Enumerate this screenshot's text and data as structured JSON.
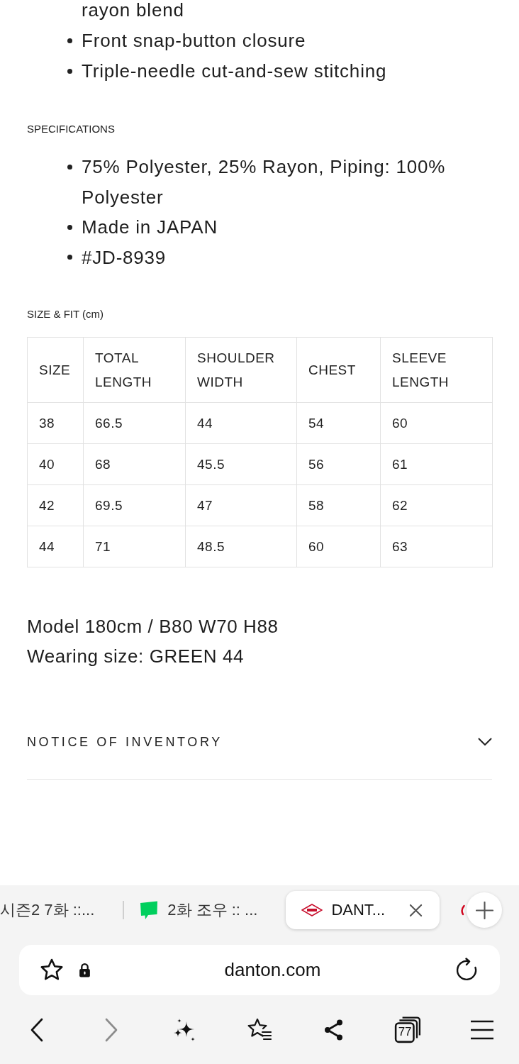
{
  "product_features": [
    {
      "kind": "continuation",
      "text": "rayon blend"
    },
    {
      "kind": "bullet",
      "text": "Front snap-button closure"
    },
    {
      "kind": "bullet",
      "text": "Triple-needle cut-and-sew stitching"
    }
  ],
  "specifications": {
    "heading": "SPECIFICATIONS",
    "items": [
      "75% Polyester, 25% Rayon, Piping: 100% Polyester",
      "Made in JAPAN",
      "#JD-8939"
    ]
  },
  "size_fit": {
    "heading": "SIZE & FIT (cm)",
    "table": {
      "columns": [
        "SIZE",
        "TOTAL LENGTH",
        "SHOULDER WIDTH",
        "CHEST",
        "SLEEVE LENGTH"
      ],
      "rows": [
        [
          "38",
          "66.5",
          "44",
          "54",
          "60"
        ],
        [
          "40",
          "68",
          "45.5",
          "56",
          "61"
        ],
        [
          "42",
          "69.5",
          "47",
          "58",
          "62"
        ],
        [
          "44",
          "71",
          "48.5",
          "60",
          "63"
        ]
      ]
    }
  },
  "model_info": [
    "Model 180cm / B80 W70 H88",
    "Wearing size: GREEN 44"
  ],
  "notice": {
    "title": "NOTICE OF INVENTORY",
    "expanded": false
  },
  "browser": {
    "tabs": [
      {
        "kind": "plain",
        "title": "시즌2 7화 ::...",
        "selected": false
      },
      {
        "kind": "chat",
        "title": "2화 조우 :: ...",
        "selected": false
      },
      {
        "kind": "logo",
        "title": "DANT...",
        "selected": true
      }
    ],
    "address_bar": {
      "url": "danton.com",
      "secure": true
    },
    "toolbar": [
      {
        "kind": "back",
        "disabled": false
      },
      {
        "kind": "forward",
        "disabled": true
      },
      {
        "kind": "assistant",
        "disabled": false
      },
      {
        "kind": "bookmarks",
        "disabled": false
      },
      {
        "kind": "share",
        "disabled": false
      },
      {
        "kind": "tabs",
        "count": "77",
        "disabled": false
      },
      {
        "kind": "menu",
        "disabled": false
      }
    ]
  }
}
